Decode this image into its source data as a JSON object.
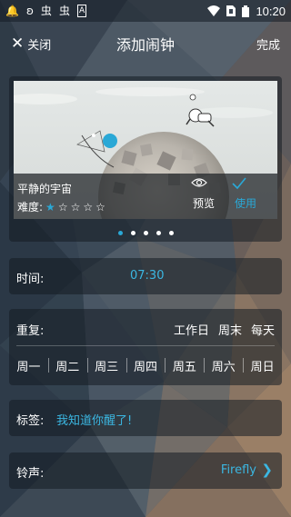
{
  "status_bar": {
    "time": "10:20",
    "icons": [
      "bell-icon",
      "app-icon",
      "app-icon",
      "app-icon",
      "text-a-icon",
      "wifi-icon",
      "no-sim-icon",
      "battery-icon"
    ]
  },
  "header": {
    "close_label": "关闭",
    "title": "添加闹钟",
    "done_label": "完成"
  },
  "ringtone_card": {
    "name": "平静的宇宙",
    "difficulty_label": "难度:",
    "difficulty_rating": 1,
    "difficulty_max": 5,
    "preview_label": "预览",
    "use_label": "使用",
    "page_count": 5,
    "active_page": 1
  },
  "time_setting": {
    "label": "时间:",
    "value": "07:30"
  },
  "repeat_setting": {
    "label": "重复:",
    "presets": [
      "工作日",
      "周末",
      "每天"
    ],
    "weekdays": [
      "周一",
      "周二",
      "周三",
      "周四",
      "周五",
      "周六",
      "周日"
    ]
  },
  "tag_setting": {
    "label": "标签:",
    "value": "我知道你醒了!"
  },
  "sound_setting": {
    "label": "铃声:",
    "value": "Firefly"
  },
  "colors": {
    "accent": "#3bb7e2",
    "panel": "rgba(20,28,34,0.55)"
  }
}
